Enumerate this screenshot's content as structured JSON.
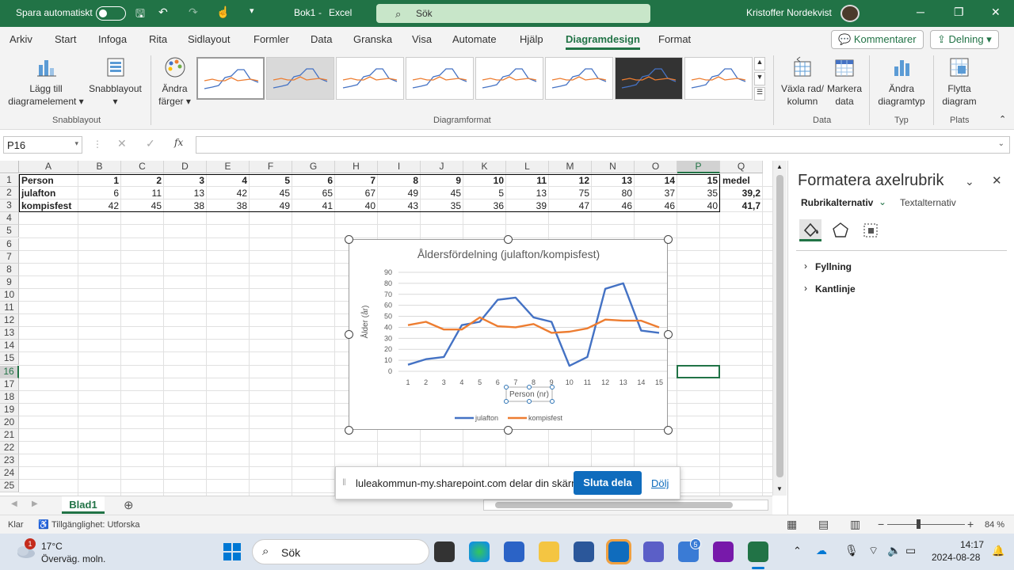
{
  "titlebar": {
    "autosave_label": "Spara automatiskt",
    "doc_title": "Bok1",
    "sep": "-",
    "app_name": "Excel",
    "search_placeholder": "Sök",
    "user_name": "Kristoffer Nordekvist"
  },
  "tabs": [
    "Arkiv",
    "Start",
    "Infoga",
    "Rita",
    "Sidlayout",
    "Formler",
    "Data",
    "Granska",
    "Visa",
    "Automate",
    "Hjälp",
    "Diagramdesign",
    "Format"
  ],
  "active_tab": "Diagramdesign",
  "topbuttons": {
    "comments": "Kommentarer",
    "share": "Delning"
  },
  "ribbon": {
    "add_element": [
      "Lägg till",
      "diagramelement"
    ],
    "quick_layout": "Snabblayout",
    "change_colors": [
      "Ändra",
      "färger"
    ],
    "group_quicklayout": "Snabblayout",
    "group_styles": "Diagramformat",
    "switch_row": [
      "Växla rad/",
      "kolumn"
    ],
    "select_data": [
      "Markera",
      "data"
    ],
    "group_data": "Data",
    "change_type": [
      "Ändra",
      "diagramtyp"
    ],
    "group_type": "Typ",
    "move_chart": [
      "Flytta",
      "diagram"
    ],
    "group_location": "Plats"
  },
  "formula_bar": {
    "cell_ref": "P16",
    "fx": "fx",
    "content": ""
  },
  "grid": {
    "columns": [
      "A",
      "B",
      "C",
      "D",
      "E",
      "F",
      "G",
      "H",
      "I",
      "J",
      "K",
      "L",
      "M",
      "N",
      "O",
      "P",
      "Q"
    ],
    "selected_column": "P",
    "selected_row": "16",
    "row_numbers": [
      "1",
      "2",
      "3",
      "4",
      "5",
      "6",
      "7",
      "8",
      "9",
      "10",
      "11",
      "12",
      "13",
      "14",
      "15",
      "16",
      "17",
      "18",
      "19",
      "20",
      "21",
      "22",
      "23",
      "24",
      "25"
    ],
    "rows": [
      [
        "Person",
        "1",
        "2",
        "3",
        "4",
        "5",
        "6",
        "7",
        "8",
        "9",
        "10",
        "11",
        "12",
        "13",
        "14",
        "15",
        "medel"
      ],
      [
        "julafton",
        "6",
        "11",
        "13",
        "42",
        "45",
        "65",
        "67",
        "49",
        "45",
        "5",
        "13",
        "75",
        "80",
        "37",
        "35",
        "39,2"
      ],
      [
        "kompisfest",
        "42",
        "45",
        "38",
        "38",
        "49",
        "41",
        "40",
        "43",
        "35",
        "36",
        "39",
        "47",
        "46",
        "46",
        "40",
        "41,7"
      ]
    ]
  },
  "chart_data": {
    "type": "line",
    "title": "Åldersfördelning (julafton/kompisfest)",
    "xlabel": "Person (nr)",
    "ylabel": "Ålder (år)",
    "categories": [
      "1",
      "2",
      "3",
      "4",
      "5",
      "6",
      "7",
      "8",
      "9",
      "10",
      "11",
      "12",
      "13",
      "14",
      "15"
    ],
    "yticks": [
      "0",
      "10",
      "20",
      "30",
      "40",
      "50",
      "60",
      "70",
      "80",
      "90"
    ],
    "ylim": [
      0,
      90
    ],
    "grid": true,
    "legend": "bottom",
    "series": [
      {
        "name": "julafton",
        "color": "#4472c4",
        "values": [
          6,
          11,
          13,
          42,
          45,
          65,
          67,
          49,
          45,
          5,
          13,
          75,
          80,
          37,
          35
        ]
      },
      {
        "name": "kompisfest",
        "color": "#ed7d31",
        "values": [
          42,
          45,
          38,
          38,
          49,
          41,
          40,
          43,
          35,
          36,
          39,
          47,
          46,
          46,
          40
        ]
      }
    ]
  },
  "panel": {
    "title": "Formatera axelrubrik",
    "tab1": "Rubrikalternativ",
    "tab2": "Textalternativ",
    "section1": "Fyllning",
    "section2": "Kantlinje"
  },
  "sheet": {
    "name": "Blad1"
  },
  "share_bar": {
    "message": "lulea­kommun-my.sharepoint.com delar din skärm.",
    "stop": "Sluta dela",
    "hide": "Dölj"
  },
  "status": {
    "ready": "Klar",
    "accessibility": "Tillgänglighet: Utforska",
    "zoom": "84 %"
  },
  "taskbar": {
    "weather_temp": "17°C",
    "weather_desc": "Överväg. moln.",
    "search": "Sök",
    "time": "14:17",
    "date": "2024-08-28",
    "notif_badge": "1",
    "badge_5": "5"
  },
  "colors": {
    "excel_green": "#217346",
    "series1": "#4472c4",
    "series2": "#ed7d31"
  }
}
